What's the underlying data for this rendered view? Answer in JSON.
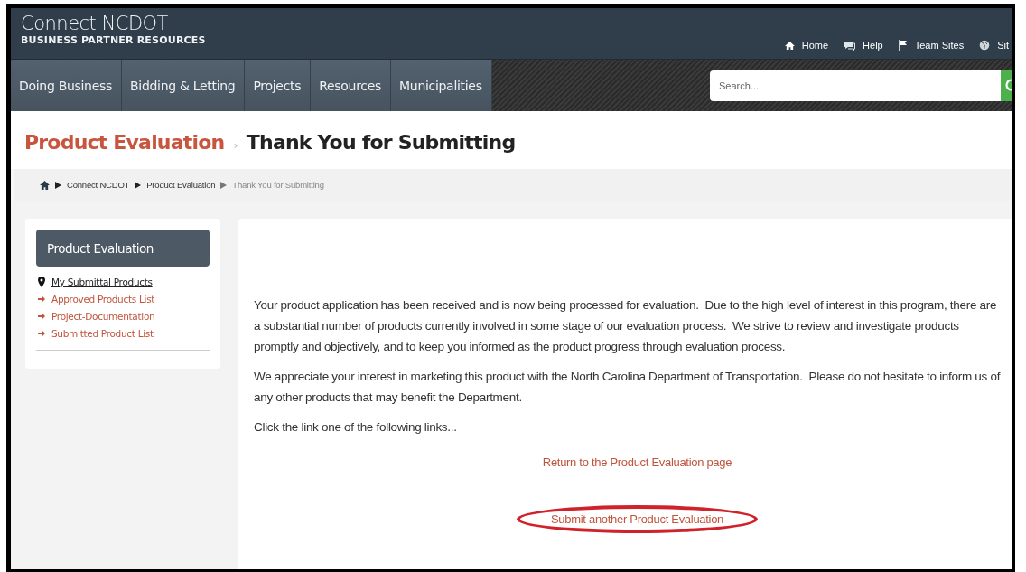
{
  "header": {
    "logo_title": "Connect NCDOT",
    "logo_subtitle": "BUSINESS PARTNER RESOURCES",
    "top_links": [
      {
        "label": "Home"
      },
      {
        "label": "Help"
      },
      {
        "label": "Team Sites"
      },
      {
        "label": "Sit"
      }
    ]
  },
  "nav": {
    "items": [
      {
        "label": "Doing Business"
      },
      {
        "label": "Bidding & Letting"
      },
      {
        "label": "Projects"
      },
      {
        "label": "Resources"
      },
      {
        "label": "Municipalities"
      }
    ],
    "search": {
      "placeholder": "Search..."
    }
  },
  "page_title": {
    "section": "Product Evaluation",
    "separator": "›",
    "title": "Thank You for Submitting"
  },
  "breadcrumb": [
    {
      "label": "Connect NCDOT",
      "current": false
    },
    {
      "label": "Product Evaluation",
      "current": false
    },
    {
      "label": "Thank You for Submitting",
      "current": true
    }
  ],
  "sidebar": {
    "heading": "Product Evaluation",
    "items": [
      {
        "label": "My Submittal Products",
        "selected": true
      },
      {
        "label": "Approved Products List",
        "selected": false
      },
      {
        "label": "Project-Documentation",
        "selected": false
      },
      {
        "label": "Submitted Product List",
        "selected": false
      }
    ]
  },
  "content": {
    "paragraphs": [
      "Your product application has been received and is now being processed for evaluation.  Due to the high level of interest in this program, there are a substantial number of products currently involved in some stage of our evaluation process.  We strive to review and investigate products promptly and objectively, and to keep you informed as the product progress through evaluation process.",
      "We appreciate your interest in marketing this product with the North Carolina Department of Transportation.  Please do not hesitate to inform us of any other products that may benefit the Department.",
      "Click the link one of the following links..."
    ],
    "links": [
      {
        "label": "Return to the Product Evaluation page",
        "highlighted": false
      },
      {
        "label": "Submit another Product Evaluation",
        "highlighted": true
      }
    ]
  }
}
